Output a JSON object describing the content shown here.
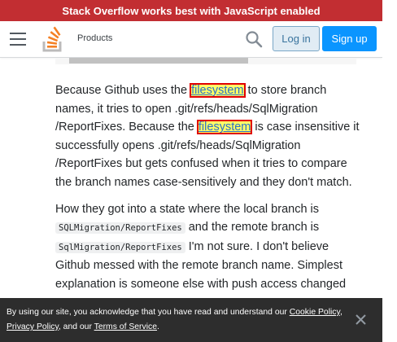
{
  "banner": {
    "text": "Stack Overflow works best with JavaScript enabled"
  },
  "topbar": {
    "menu_icon": "hamburger-icon",
    "logo_icon": "stackoverflow-logo",
    "products": "Products",
    "search_icon": "search-icon",
    "login": "Log in",
    "signup": "Sign up"
  },
  "colors": {
    "banner_bg": "#c22e32",
    "primary_button": "#0a95ff",
    "secondary_button_bg": "#e1ecf4",
    "highlight": "#ffff66",
    "highlight_border": "#e00000",
    "cookie_bg": "#2d2d2d"
  },
  "answer": {
    "p1": {
      "t1": "Because Github uses the ",
      "link1": "filesystem",
      "t2": " to store branch names, it tries to open .git/refs/heads/SqlMigration /ReportFixes. Because the ",
      "link2": "filesystem",
      "t3": " is case insensitive it successfully opens .git/refs/heads/SqlMigration /ReportFixes but gets confused when it tries to compare the branch names case-sensitively and they don't match."
    },
    "p2": {
      "t1": "How they got into a state where the local branch is ",
      "code1": "SQLMigration/ReportFixes",
      "t2": " and the remote branch is ",
      "code2": "SqlMigration/ReportFixes",
      "t3": " I'm not sure. I don't believe Github messed with the remote branch name. Simplest explanation is someone else with push access changed"
    }
  },
  "cookie": {
    "t1": "By using our site, you acknowledge that you have read and understand our ",
    "cookie_policy": "Cookie Policy",
    "sep1": ", ",
    "privacy_policy": "Privacy Policy",
    "t2": ", and our ",
    "terms": "Terms of Service",
    "t3": ".",
    "close_icon": "close-icon"
  }
}
